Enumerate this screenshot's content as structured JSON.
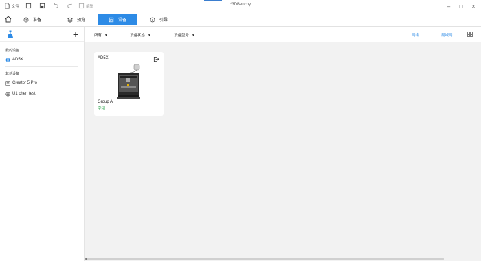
{
  "titlebar": {
    "file_label": "文件",
    "edit_label": "编辑",
    "document_title": "*3DBenchy",
    "minimize": "–",
    "restore": "□",
    "close": "×"
  },
  "tabs": [
    {
      "label": "准备",
      "icon": "clock-icon"
    },
    {
      "label": "预览",
      "icon": "layers-icon"
    },
    {
      "label": "设备",
      "icon": "device-icon",
      "active": true
    },
    {
      "label": "引导",
      "icon": "compass-icon"
    }
  ],
  "sidebar": {
    "add_label": "+",
    "my_devices_title": "我的设备",
    "my_devices": [
      {
        "name": "AD5X",
        "icon": "globe-icon"
      }
    ],
    "other_devices_title": "其他设备",
    "other_devices": [
      {
        "name": "Creator 5 Pro",
        "icon": "network-icon"
      },
      {
        "name": "U1 chen test",
        "icon": "globe-icon"
      }
    ]
  },
  "filters": {
    "all": "所有",
    "status": "设备状态",
    "model": "设备型号",
    "caret": "▼"
  },
  "network": {
    "wan": "网络",
    "lan": "局域网"
  },
  "device_card": {
    "name": "AD5X",
    "group": "Group A",
    "status": "空闲"
  },
  "colors": {
    "accent": "#2d8be6",
    "status_idle": "#2aa44a",
    "background": "#f2f2f2"
  }
}
